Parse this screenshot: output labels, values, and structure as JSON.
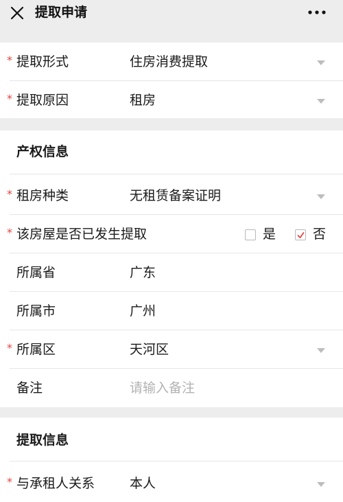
{
  "header": {
    "title": "提取申请",
    "close_icon": "close-icon",
    "more_icon": "more-icon"
  },
  "section1": {
    "rows": [
      {
        "label": "提取形式",
        "value": "住房消费提取",
        "required": true,
        "dropdown": true
      },
      {
        "label": "提取原因",
        "value": "租房",
        "required": true,
        "dropdown": true
      }
    ]
  },
  "section2": {
    "title": "产权信息",
    "rent_type": {
      "label": "租房种类",
      "value": "无租赁备案证明",
      "required": true
    },
    "withdrawn": {
      "label": "该房屋是否已发生提取",
      "required": true,
      "options": [
        {
          "label": "是",
          "checked": false
        },
        {
          "label": "否",
          "checked": true
        }
      ]
    },
    "province": {
      "label": "所属省",
      "value": "广东"
    },
    "city": {
      "label": "所属市",
      "value": "广州"
    },
    "district": {
      "label": "所属区",
      "value": "天河区",
      "required": true
    },
    "remark": {
      "label": "备注",
      "placeholder": "请输入备注"
    }
  },
  "section3": {
    "title": "提取信息",
    "relation": {
      "label": "与承租人关系",
      "value": "本人",
      "required": true
    }
  },
  "colors": {
    "required": "#e64340",
    "check": "#e64340",
    "background": "#ededed",
    "placeholder": "#b2b2b2"
  }
}
